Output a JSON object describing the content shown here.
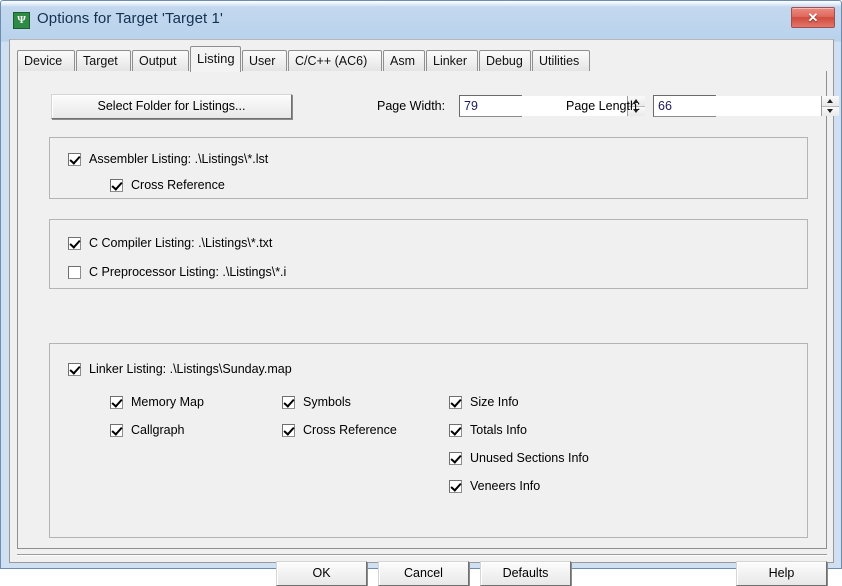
{
  "window": {
    "title": "Options for Target 'Target 1'",
    "icon": "keil-uvision-icon",
    "icon_glyph": "Ψ",
    "close_label": "✕",
    "titlebar_color": "#b9d2ec",
    "client_color": "#f0f0f0"
  },
  "tabs": [
    {
      "label": "Device",
      "selected": false
    },
    {
      "label": "Target",
      "selected": false
    },
    {
      "label": "Output",
      "selected": false
    },
    {
      "label": "Listing",
      "selected": true
    },
    {
      "label": "User",
      "selected": false
    },
    {
      "label": "C/C++ (AC6)",
      "selected": false
    },
    {
      "label": "Asm",
      "selected": false
    },
    {
      "label": "Linker",
      "selected": false
    },
    {
      "label": "Debug",
      "selected": false
    },
    {
      "label": "Utilities",
      "selected": false
    }
  ],
  "toolbar": {
    "select_folder_label": "Select Folder for Listings...",
    "page_width_label": "Page Width:",
    "page_width_value": "79",
    "page_length_label": "Page Length:",
    "page_length_value": "66"
  },
  "assembler_group": {
    "listing": {
      "label": "Assembler Listing:  .\\Listings\\*.lst",
      "checked": true
    },
    "cross_reference": {
      "label": "Cross Reference",
      "checked": true
    }
  },
  "compiler_group": {
    "compiler_listing": {
      "label": "C Compiler Listing:  .\\Listings\\*.txt",
      "checked": true
    },
    "preprocessor_listing": {
      "label": "C Preprocessor Listing:  .\\Listings\\*.i",
      "checked": false
    }
  },
  "linker_group": {
    "linker_listing": {
      "label": "Linker Listing:  .\\Listings\\Sunday.map",
      "checked": true
    },
    "col1": [
      {
        "label": "Memory Map",
        "checked": true
      },
      {
        "label": "Callgraph",
        "checked": true
      }
    ],
    "col2": [
      {
        "label": "Symbols",
        "checked": true
      },
      {
        "label": "Cross Reference",
        "checked": true
      }
    ],
    "col3": [
      {
        "label": "Size Info",
        "checked": true
      },
      {
        "label": "Totals Info",
        "checked": true
      },
      {
        "label": "Unused Sections Info",
        "checked": true
      },
      {
        "label": "Veneers Info",
        "checked": true
      }
    ]
  },
  "footer": {
    "ok": "OK",
    "cancel": "Cancel",
    "defaults": "Defaults",
    "help": "Help"
  }
}
